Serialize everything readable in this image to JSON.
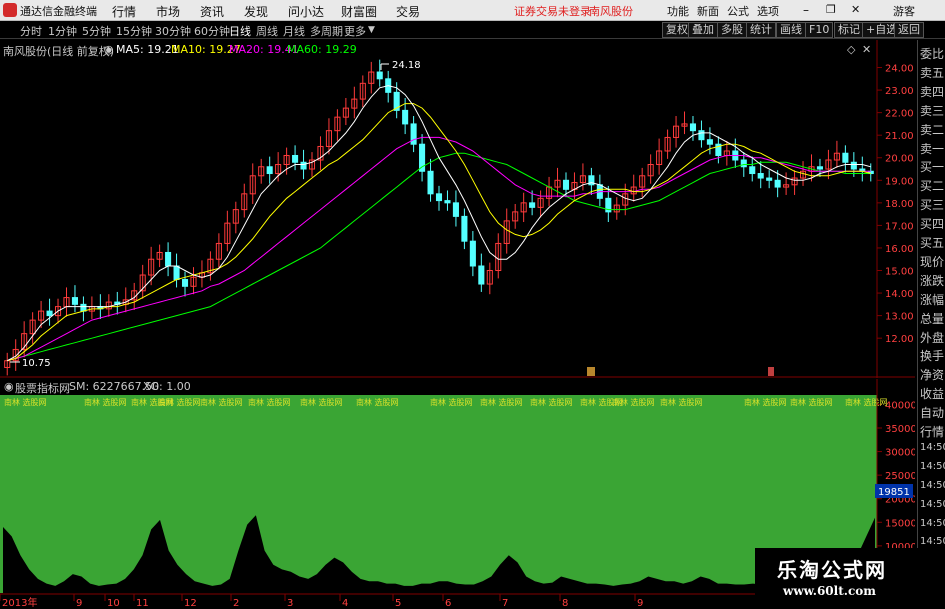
{
  "app": {
    "title": "通达信金融终端"
  },
  "menu": [
    "行情",
    "市场",
    "资讯",
    "发现",
    "问小达",
    "财富圈",
    "交易"
  ],
  "notice": {
    "login": "证券交易未登录",
    "stock": "南风股份"
  },
  "right_menu": [
    "功能",
    "新面",
    "公式",
    "选项",
    "游客"
  ],
  "periods": [
    "分时",
    "1分钟",
    "5分钟",
    "15分钟",
    "30分钟",
    "60分钟",
    "日线",
    "周线",
    "月线",
    "多周期",
    "更多"
  ],
  "active_period": "日线",
  "toolbar_buttons": [
    "复权",
    "叠加",
    "多股",
    "统计",
    "画线",
    "F10",
    "标记",
    "+自选",
    "返回"
  ],
  "main_legend": {
    "stock": "南风股份(日线 前复权)",
    "ma5": "MA5: 19.21",
    "ma10": "MA10: 19.27",
    "ma20": "MA20: 19.41",
    "ma60": "MA60: 19.29"
  },
  "sub_legend": {
    "name": "股票指标网",
    "sm": "SM: 6227667.50",
    "xg": "XG: 1.00"
  },
  "colors": {
    "up": "#ff3b3b",
    "down": "#54ffff",
    "ma5": "#ffffff",
    "ma10": "#ffff00",
    "ma20": "#ff00ff",
    "ma60": "#00ff00",
    "sub_bg": "#3aa534"
  },
  "chart_data": {
    "type": "candlestick",
    "price_axis": {
      "ylim": [
        10.5,
        24.6
      ],
      "ticks": [
        "24.00",
        "23.00",
        "22.00",
        "21.00",
        "20.00",
        "19.00",
        "18.00",
        "17.00",
        "16.00",
        "15.00",
        "14.00",
        "13.00",
        "12.00"
      ]
    },
    "annotations": {
      "high": "24.18",
      "low": "10.75"
    },
    "closes": [
      11.0,
      11.5,
      12.2,
      12.8,
      13.2,
      13.0,
      13.4,
      13.8,
      13.5,
      13.2,
      13.4,
      13.3,
      13.6,
      13.5,
      13.7,
      14.1,
      14.8,
      15.5,
      15.8,
      15.2,
      14.6,
      14.3,
      14.7,
      14.9,
      15.5,
      16.2,
      17.1,
      17.7,
      18.4,
      19.2,
      19.6,
      19.3,
      19.7,
      20.1,
      19.8,
      19.5,
      19.9,
      20.5,
      21.2,
      21.8,
      22.2,
      22.6,
      23.3,
      23.8,
      23.5,
      22.9,
      22.1,
      21.5,
      20.6,
      19.4,
      18.4,
      18.1,
      18.0,
      17.4,
      16.3,
      15.2,
      14.4,
      15.0,
      16.2,
      17.2,
      17.6,
      18.0,
      17.8,
      18.2,
      18.7,
      19.0,
      18.6,
      18.9,
      19.2,
      18.8,
      18.2,
      17.6,
      17.9,
      18.4,
      18.7,
      19.2,
      19.7,
      20.3,
      20.9,
      21.4,
      21.5,
      21.2,
      20.8,
      20.6,
      20.1,
      20.3,
      19.9,
      19.6,
      19.3,
      19.1,
      19.0,
      18.7,
      18.8,
      19.1,
      19.4,
      19.6,
      19.5,
      19.9,
      20.2,
      19.8,
      19.5,
      19.4,
      19.3
    ],
    "ma5": [
      11.0,
      11.2,
      11.6,
      12.1,
      12.6,
      12.9,
      13.2,
      13.4,
      13.4,
      13.4,
      13.4,
      13.4,
      13.4,
      13.5,
      13.6,
      13.8,
      14.2,
      14.6,
      15.0,
      15.2,
      15.2,
      15.0,
      14.8,
      14.7,
      14.8,
      15.1,
      15.6,
      16.3,
      17.0,
      17.7,
      18.4,
      18.8,
      19.2,
      19.5,
      19.7,
      19.7,
      19.8,
      20.0,
      20.3,
      20.7,
      21.1,
      21.6,
      22.2,
      22.7,
      23.1,
      23.2,
      23.1,
      22.8,
      22.3,
      21.6,
      20.8,
      20.0,
      19.4,
      18.8,
      18.1,
      17.3,
      16.5,
      15.8,
      15.5,
      15.5,
      15.8,
      16.3,
      16.9,
      17.4,
      17.8,
      18.1,
      18.4,
      18.6,
      18.8,
      18.9,
      18.8,
      18.6,
      18.4,
      18.2,
      18.1,
      18.2,
      18.6,
      19.1,
      19.6,
      20.2,
      20.7,
      21.0,
      21.1,
      21.1,
      20.9,
      20.7,
      20.5,
      20.2,
      20.0,
      19.7,
      19.5,
      19.3,
      19.1,
      19.0,
      19.0,
      19.1,
      19.3,
      19.4,
      19.6,
      19.7,
      19.7,
      19.7,
      19.6
    ],
    "ma10": [
      11.0,
      11.1,
      11.4,
      11.7,
      12.1,
      12.4,
      12.7,
      13.0,
      13.1,
      13.2,
      13.3,
      13.3,
      13.4,
      13.4,
      13.5,
      13.6,
      13.8,
      14.0,
      14.2,
      14.4,
      14.6,
      14.7,
      14.8,
      14.9,
      15.0,
      15.1,
      15.3,
      15.6,
      16.0,
      16.4,
      16.9,
      17.4,
      17.8,
      18.2,
      18.5,
      18.8,
      19.1,
      19.4,
      19.7,
      19.9,
      20.2,
      20.5,
      20.8,
      21.2,
      21.6,
      22.0,
      22.2,
      22.4,
      22.4,
      22.2,
      21.8,
      21.3,
      20.8,
      20.3,
      19.7,
      19.0,
      18.3,
      17.6,
      17.1,
      16.8,
      16.6,
      16.5,
      16.6,
      16.8,
      17.1,
      17.5,
      17.8,
      18.1,
      18.3,
      18.5,
      18.6,
      18.6,
      18.6,
      18.6,
      18.5,
      18.5,
      18.6,
      18.8,
      19.0,
      19.3,
      19.6,
      19.9,
      20.2,
      20.4,
      20.5,
      20.6,
      20.6,
      20.5,
      20.3,
      20.2,
      20.0,
      19.8,
      19.6,
      19.4,
      19.3,
      19.2,
      19.2,
      19.2,
      19.3,
      19.4,
      19.4,
      19.4,
      19.3
    ],
    "ma20": [
      11.0,
      11.1,
      11.2,
      11.4,
      11.6,
      11.8,
      12.0,
      12.2,
      12.4,
      12.6,
      12.8,
      12.9,
      13.0,
      13.1,
      13.2,
      13.3,
      13.4,
      13.5,
      13.6,
      13.7,
      13.8,
      13.9,
      14.0,
      14.1,
      14.3,
      14.4,
      14.6,
      14.8,
      15.0,
      15.3,
      15.6,
      15.9,
      16.2,
      16.5,
      16.8,
      17.1,
      17.4,
      17.7,
      18.0,
      18.3,
      18.6,
      18.9,
      19.2,
      19.5,
      19.8,
      20.1,
      20.4,
      20.6,
      20.8,
      20.9,
      20.9,
      20.9,
      20.8,
      20.7,
      20.5,
      20.3,
      20.0,
      19.7,
      19.4,
      19.1,
      18.8,
      18.6,
      18.4,
      18.3,
      18.3,
      18.3,
      18.3,
      18.3,
      18.4,
      18.4,
      18.5,
      18.5,
      18.5,
      18.5,
      18.5,
      18.6,
      18.6,
      18.7,
      18.9,
      19.1,
      19.3,
      19.5,
      19.7,
      19.9,
      20.0,
      20.1,
      20.1,
      20.1,
      20.0,
      20.0,
      19.9,
      19.8,
      19.7,
      19.6,
      19.5,
      19.4,
      19.4,
      19.4,
      19.4,
      19.4,
      19.4,
      19.4,
      19.4
    ],
    "ma60": [
      11.0,
      11.1,
      11.2,
      11.3,
      11.4,
      11.5,
      11.6,
      11.7,
      11.8,
      11.9,
      12.0,
      12.1,
      12.2,
      12.3,
      12.4,
      12.5,
      12.6,
      12.7,
      12.8,
      12.9,
      13.0,
      13.1,
      13.2,
      13.3,
      13.4,
      13.6,
      13.8,
      14.0,
      14.2,
      14.4,
      14.6,
      14.8,
      15.0,
      15.2,
      15.4,
      15.6,
      15.8,
      16.0,
      16.3,
      16.6,
      16.9,
      17.2,
      17.5,
      17.8,
      18.1,
      18.4,
      18.7,
      19.0,
      19.3,
      19.6,
      19.8,
      20.0,
      20.1,
      20.2,
      20.2,
      20.1,
      20.0,
      19.9,
      19.8,
      19.7,
      19.5,
      19.3,
      19.1,
      18.9,
      18.7,
      18.5,
      18.3,
      18.1,
      18.0,
      17.9,
      17.8,
      17.7,
      17.7,
      17.7,
      17.8,
      17.9,
      18.0,
      18.1,
      18.3,
      18.5,
      18.7,
      18.9,
      19.1,
      19.3,
      19.4,
      19.5,
      19.6,
      19.7,
      19.7,
      19.8,
      19.8,
      19.8,
      19.8,
      19.7,
      19.6,
      19.5,
      19.4,
      19.4,
      19.4,
      19.3,
      19.3,
      19.3,
      19.3
    ],
    "sub_axis": {
      "ylim": [
        0,
        42000
      ],
      "ticks": [
        "40000",
        "35000",
        "30000",
        "25000",
        "20000",
        "15000",
        "10000"
      ],
      "highlight": "19851"
    },
    "sub_values": [
      14000,
      12000,
      8000,
      5000,
      3000,
      2000,
      1500,
      2500,
      4000,
      3500,
      2000,
      1500,
      1800,
      2000,
      3000,
      5000,
      8000,
      13500,
      15500,
      9000,
      6000,
      4000,
      2500,
      2000,
      1500,
      1800,
      3000,
      9000,
      14500,
      16500,
      9000,
      6000,
      5000,
      4500,
      3500,
      3000,
      4000,
      6000,
      7500,
      6500,
      4500,
      3000,
      2500,
      2500,
      2000,
      2000,
      1500,
      1500,
      2000,
      2000,
      2500,
      2500,
      2000,
      1800,
      1800,
      2500,
      3500,
      6000,
      8000,
      6500,
      3500,
      2500,
      2000,
      2200,
      3500,
      3000,
      2500,
      2000,
      2000,
      1800,
      1500,
      1800,
      2000,
      2500,
      3500,
      3000,
      2500,
      2500,
      2000,
      2500,
      3500,
      3000,
      2000,
      2000,
      1800,
      1800,
      2000,
      1800,
      1500,
      2000,
      2000,
      2500,
      3500,
      3000,
      2500,
      2000,
      3000,
      5000,
      8000,
      12000,
      16000
    ],
    "date_axis": [
      "2013年",
      "9",
      "10",
      "11",
      "12",
      "2",
      "3",
      "4",
      "5",
      "6",
      "7",
      "8",
      "9"
    ],
    "sub_signal_label": "南林 选股网"
  },
  "right_panel": [
    "委比",
    "卖五",
    "卖四",
    "卖三",
    "卖二",
    "卖一",
    "买一",
    "买二",
    "买三",
    "买四",
    "买五",
    "现价",
    "涨跌",
    "涨幅",
    "总量",
    "外盘",
    "换手",
    "净资",
    "收益",
    "自动",
    "行情",
    "14:50",
    "14:50",
    "14:50",
    "14:50",
    "14:50",
    "14:50",
    "14:50",
    "14:50"
  ],
  "watermark": {
    "title": "乐淘公式网",
    "url": "www.60lt.com"
  }
}
